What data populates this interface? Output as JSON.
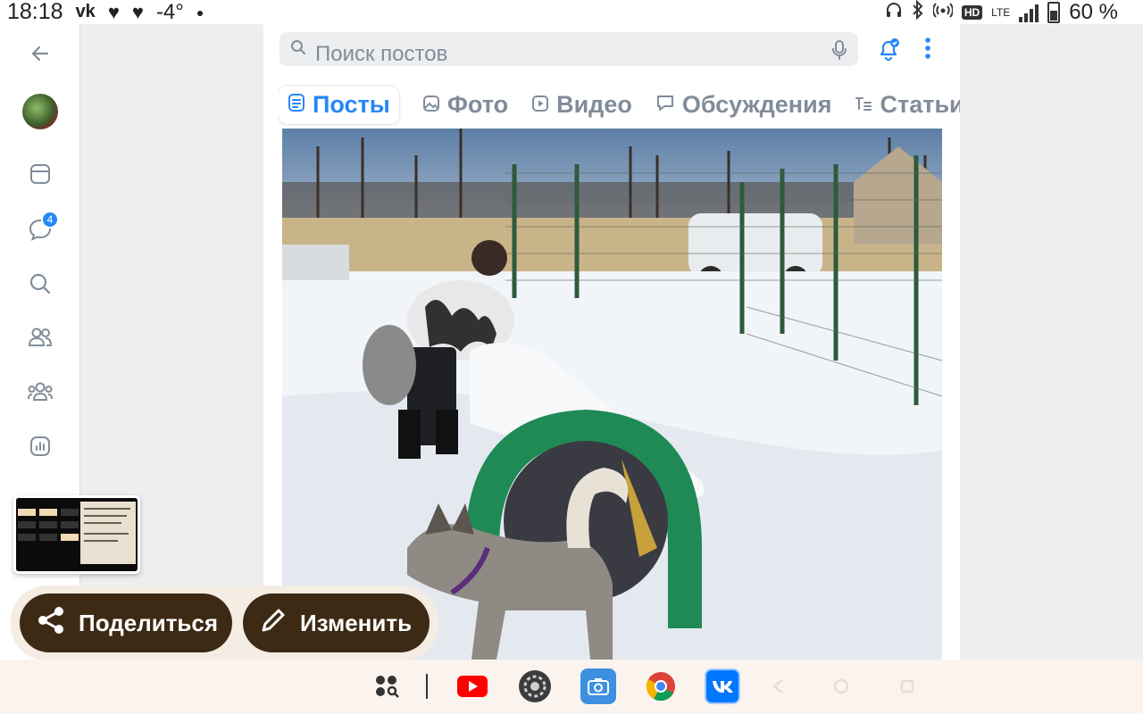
{
  "status_bar": {
    "time": "18:18",
    "vk_label": "vk",
    "temperature": "-4°",
    "lte": "LTE",
    "hd": "HD",
    "battery": "60 %"
  },
  "rail": {
    "chat_badge": "4"
  },
  "search": {
    "placeholder": "Поиск постов"
  },
  "tabs": [
    {
      "label": "Посты",
      "icon": "posts-icon",
      "active": true
    },
    {
      "label": "Фото",
      "icon": "photo-icon",
      "active": false
    },
    {
      "label": "Видео",
      "icon": "video-icon",
      "active": false
    },
    {
      "label": "Обсуждения",
      "icon": "discussions-icon",
      "active": false
    },
    {
      "label": "Статьи",
      "icon": "articles-icon",
      "active": false
    }
  ],
  "actions": {
    "share_label": "Поделиться",
    "edit_label": "Изменить"
  },
  "colors": {
    "accent": "#2787f5",
    "action_button": "#3d2a14",
    "muted": "#818c99"
  }
}
